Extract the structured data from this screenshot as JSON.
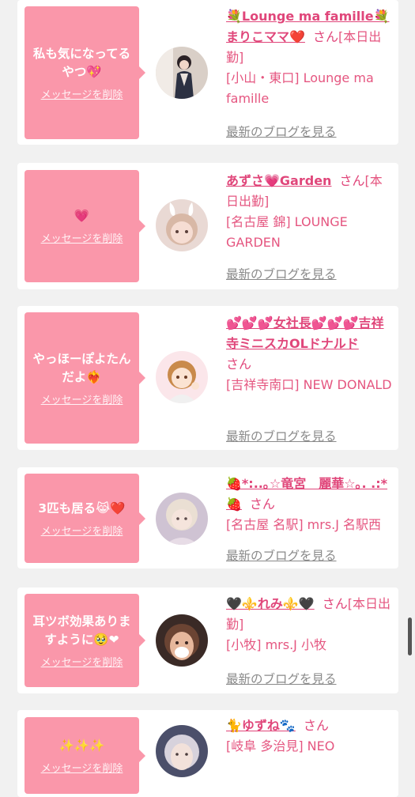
{
  "delete_label": "メッセージを削除",
  "blog_label": "最新のブログを見る",
  "san": "さん",
  "colors": {
    "bubble": "#fa97aa",
    "accent": "#e0467a",
    "link_gray": "#8a8a8a",
    "background": "#f1f1f1"
  },
  "cards": [
    {
      "message": "私も気になってるやつ💖",
      "name": "💐Lounge ma famille💐まりこママ❤️",
      "badge": "[本日出勤]",
      "shop": "[小山・東口] Lounge ma famille",
      "avatar": "woman-in-kimono"
    },
    {
      "message": "💗",
      "name": "あずさ💗Garden",
      "badge": "[本日出勤]",
      "shop": "[名古屋 錦] LOUNGE GARDEN",
      "avatar": "girl-with-bunny-ears"
    },
    {
      "message": "やっほーぽよたんだよ❤️‍🔥",
      "name": "💕💕💕女社長💕💕💕吉祥寺ミニスカOLドナルド",
      "badge": "",
      "shop": "[吉祥寺南口] NEW DONALD",
      "avatar": "anime-girl"
    },
    {
      "message": "3匹も居る😹❤️",
      "name": "🍓*:..｡☆竜宮　麗華☆｡. .:*🍓",
      "badge": "",
      "shop": "[名古屋 名駅] mrs.J 名駅西",
      "avatar": "blonde-woman"
    },
    {
      "message": "耳ツボ効果ありますように🥹❤",
      "name": "🖤⚜️れみ⚜️🖤",
      "badge": "[本日出勤]",
      "shop": "[小牧] mrs.J 小牧",
      "avatar": "woman-portrait"
    },
    {
      "message": "✨✨✨",
      "name": "🐈ゆずね🐾",
      "badge": "",
      "shop": "[岐阜 多治見] NEO",
      "avatar": "silver-hair-woman"
    }
  ]
}
